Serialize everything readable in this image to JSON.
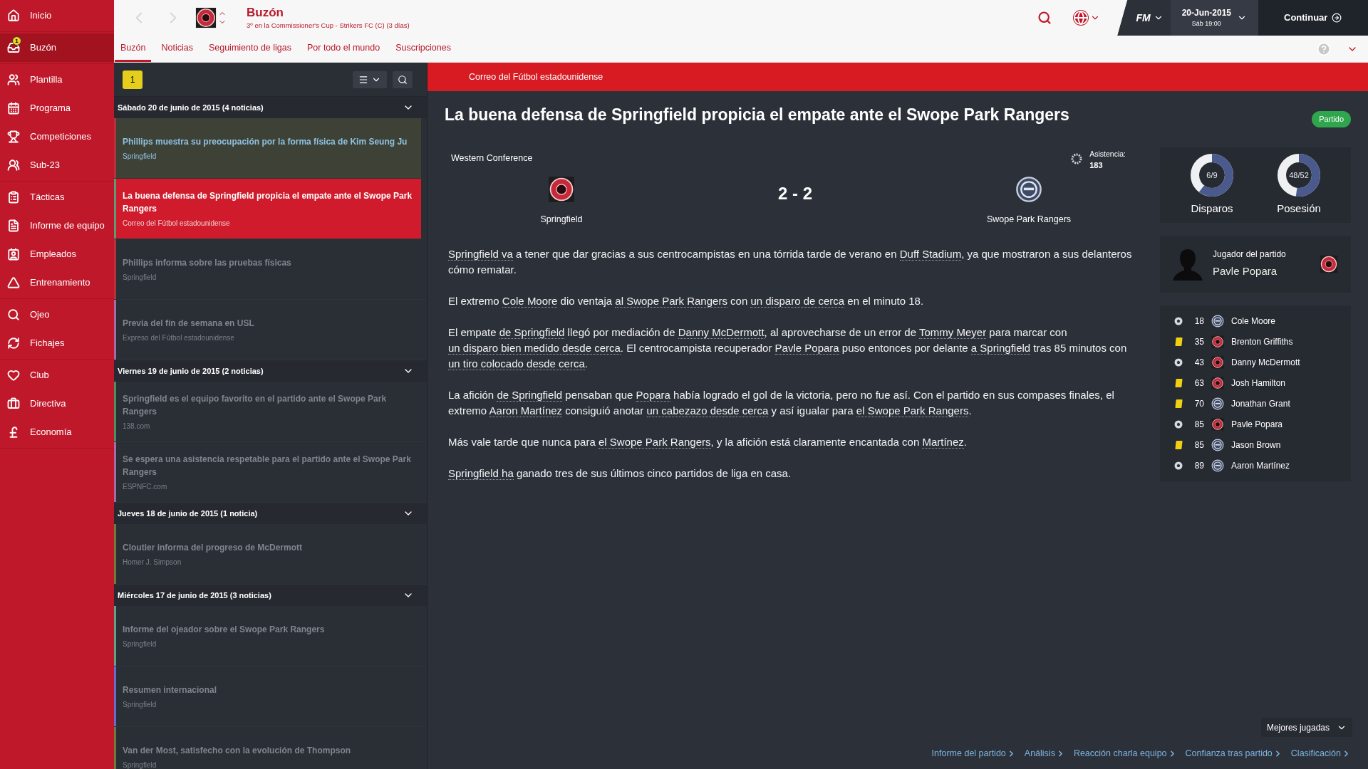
{
  "sidebar": {
    "groups": [
      [
        {
          "label": "Inicio",
          "selected": false
        }
      ],
      [
        {
          "label": "Buzón",
          "selected": true,
          "badge": "1"
        }
      ],
      [
        {
          "label": "Plantilla",
          "selected": false
        },
        {
          "label": "Programa",
          "selected": false
        },
        {
          "label": "Competiciones",
          "selected": false
        },
        {
          "label": "Sub-23",
          "selected": false
        }
      ],
      [
        {
          "label": "Tácticas",
          "selected": false
        },
        {
          "label": "Informe de equipo",
          "selected": false
        },
        {
          "label": "Empleados",
          "selected": false
        },
        {
          "label": "Entrenamiento",
          "selected": false
        }
      ],
      [
        {
          "label": "Ojeo",
          "selected": false
        },
        {
          "label": "Fichajes",
          "selected": false
        }
      ],
      [
        {
          "label": "Club",
          "selected": false
        },
        {
          "label": "Directiva",
          "selected": false
        },
        {
          "label": "Economía",
          "selected": false
        }
      ]
    ]
  },
  "header": {
    "title": "Buzón",
    "subtitle": "3º en la Commissioner's Cup - Strikers FC (C) (3 días)",
    "logo": "FM",
    "date": "20-Jun-2015",
    "time": "Sáb 19:00",
    "continue": "Continuar"
  },
  "tabs": [
    {
      "label": "Buzón",
      "selected": true
    },
    {
      "label": "Noticias",
      "selected": false
    },
    {
      "label": "Seguimiento de ligas",
      "selected": false
    },
    {
      "label": "Por todo el mundo",
      "selected": false
    },
    {
      "label": "Suscripciones",
      "selected": false
    }
  ],
  "inbox": {
    "unread_count": "1",
    "days": [
      {
        "heading": "Sábado 20 de junio de 2015 (4 noticias)",
        "items": [
          {
            "title": "Phillips muestra su preocupación por la forma física de Kim Seung Ju",
            "source": "Springfield",
            "selected": false,
            "unread": true,
            "color": "#b8323a"
          },
          {
            "title": "La buena defensa de Springfield propicia el empate ante el Swope Park Rangers",
            "source": "Correo del Fútbol estadounidense",
            "selected": true,
            "unread": false,
            "color": "#5f9a78"
          },
          {
            "title": "Phillips informa sobre las pruebas físicas",
            "source": "Springfield",
            "selected": false,
            "unread": false,
            "color": "#b8323a"
          },
          {
            "title": "Previa del fin de semana en USL",
            "source": "Expreso del Fútbol estadounidense",
            "selected": false,
            "unread": false,
            "color": "#a66aa6"
          }
        ]
      },
      {
        "heading": "Viernes 19 de junio de 2015 (2 noticias)",
        "items": [
          {
            "title": "Springfield es el equipo favorito en el partido ante el Swope Park Rangers",
            "source": "138.com",
            "selected": false,
            "unread": false,
            "color": "#4f8f5f"
          },
          {
            "title": "Se espera una asistencia respetable para el partido ante el Swope Park Rangers",
            "source": "ESPNFC.com",
            "selected": false,
            "unread": false,
            "color": "#a66aa6"
          }
        ]
      },
      {
        "heading": "Jueves 18 de junio de 2015 (1 noticia)",
        "items": [
          {
            "title": "Cloutier informa del progreso de McDermott",
            "source": "Homer J. Simpson",
            "selected": false,
            "unread": false,
            "color": "#6d7a3c"
          }
        ]
      },
      {
        "heading": "Miércoles 17 de junio de 2015 (3 noticias)",
        "items": [
          {
            "title": "Informe del ojeador sobre el Swope Park Rangers",
            "source": "Springfield",
            "selected": false,
            "unread": false,
            "color": "#5fa488"
          },
          {
            "title": "Resumen internacional",
            "source": "Springfield",
            "selected": false,
            "unread": false,
            "color": "#6a6ad0"
          },
          {
            "title": "Van der Most, satisfecho con la evolución de Thompson",
            "source": "Springfield",
            "selected": false,
            "unread": false,
            "color": "#6d7a3c"
          }
        ]
      }
    ]
  },
  "article": {
    "banner": "Correo del Fútbol estadounidense",
    "title": "La buena defensa de Springfield propicia el empate ante el Swope Park Rangers",
    "tag": "Partido",
    "match": {
      "competition": "Western Conference",
      "attendance_label": "Asistencia:",
      "attendance": "183",
      "score": "2 - 2",
      "home": "Springfield",
      "away": "Swope Park Rangers"
    },
    "paragraphs": [
      [
        {
          "text": "Springfield va",
          "link": true
        },
        {
          "text": " a tener que dar gracias a sus centrocampistas en una tórrida tarde de verano en ",
          "link": false
        },
        {
          "text": "Duff Stadium",
          "link": true
        },
        {
          "text": ", ya que mostraron a sus delanteros cómo rematar.",
          "link": false
        }
      ],
      [
        {
          "text": "El extremo ",
          "link": false
        },
        {
          "text": "Cole Moore",
          "link": true
        },
        {
          "text": " dio ventaja ",
          "link": false
        },
        {
          "text": "al Swope Park Rangers",
          "link": true
        },
        {
          "text": " con ",
          "link": false
        },
        {
          "text": "un disparo de cerca",
          "link": true
        },
        {
          "text": " en el minuto 18.",
          "link": false
        }
      ],
      [
        {
          "text": "El empate ",
          "link": false
        },
        {
          "text": "de Springfield",
          "link": true
        },
        {
          "text": " llegó por mediación de ",
          "link": false
        },
        {
          "text": "Danny McDermott",
          "link": true
        },
        {
          "text": ", al aprovecharse de un error de ",
          "link": false
        },
        {
          "text": "Tommy Meyer",
          "link": true
        },
        {
          "text": " para marcar con ",
          "link": false
        },
        {
          "text": "un disparo bien medido desde cerca",
          "link": true
        },
        {
          "text": ". El centrocampista recuperador ",
          "link": false
        },
        {
          "text": "Pavle Popara",
          "link": true
        },
        {
          "text": " puso entonces por delante ",
          "link": false
        },
        {
          "text": "a Springfield",
          "link": true
        },
        {
          "text": " tras 85 minutos con ",
          "link": false
        },
        {
          "text": "un tiro colocado desde cerca",
          "link": true
        },
        {
          "text": ".",
          "link": false
        }
      ],
      [
        {
          "text": "La afición ",
          "link": false
        },
        {
          "text": "de Springfield",
          "link": true
        },
        {
          "text": " pensaban que ",
          "link": false
        },
        {
          "text": "Popara",
          "link": true
        },
        {
          "text": " había logrado el gol de la victoria, pero no fue así. Con el partido en sus compases finales, el extremo ",
          "link": false
        },
        {
          "text": "Aaron Martínez",
          "link": true
        },
        {
          "text": " consiguió anotar ",
          "link": false
        },
        {
          "text": "un cabezazo desde cerca",
          "link": true
        },
        {
          "text": " y así igualar para ",
          "link": false
        },
        {
          "text": "el Swope Park Rangers",
          "link": true
        },
        {
          "text": ".",
          "link": false
        }
      ],
      [
        {
          "text": "Más vale tarde que nunca para ",
          "link": false
        },
        {
          "text": "el Swope Park Rangers",
          "link": true
        },
        {
          "text": ", y la afición está claramente encantada con ",
          "link": false
        },
        {
          "text": "Martínez",
          "link": true
        },
        {
          "text": ".",
          "link": false
        }
      ],
      [
        {
          "text": "Springfield ha",
          "link": true
        },
        {
          "text": " ganado tres de sus últimos cinco partidos de liga en casa.",
          "link": false
        }
      ]
    ]
  },
  "stats": [
    {
      "value": "6/9",
      "label": "Disparos"
    },
    {
      "value": "48/52",
      "label": "Posesión"
    }
  ],
  "player_of_match": {
    "label": "Jugador del partido",
    "name": "Pavle Popara"
  },
  "events": [
    {
      "kind": "goal",
      "minute": "18",
      "home": false,
      "player": "Cole Moore"
    },
    {
      "kind": "yellow",
      "minute": "35",
      "home": true,
      "player": "Brenton Griffiths"
    },
    {
      "kind": "goal",
      "minute": "43",
      "home": true,
      "player": "Danny McDermott"
    },
    {
      "kind": "yellow",
      "minute": "63",
      "home": true,
      "player": "Josh Hamilton"
    },
    {
      "kind": "yellow",
      "minute": "70",
      "home": false,
      "player": "Jonathan Grant"
    },
    {
      "kind": "goal",
      "minute": "85",
      "home": true,
      "player": "Pavle Popara"
    },
    {
      "kind": "yellow",
      "minute": "85",
      "home": false,
      "player": "Jason Brown"
    },
    {
      "kind": "goal",
      "minute": "89",
      "home": false,
      "player": "Aaron Martínez"
    }
  ],
  "highlights_dropdown": "Mejores jugadas",
  "footer_links": [
    "Informe del partido",
    "Análisis",
    "Reacción charla equipo",
    "Confianza tras partido",
    "Clasificación"
  ]
}
